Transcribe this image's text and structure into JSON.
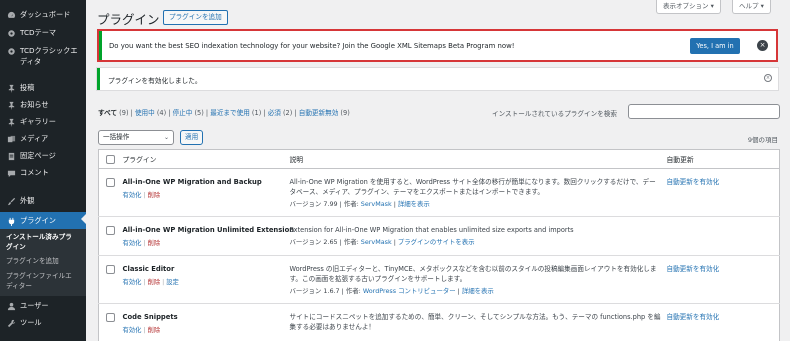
{
  "sidebar": {
    "items": [
      {
        "id": "dashboard",
        "label": "ダッシュボード",
        "icon": "dashboard-icon"
      },
      {
        "id": "tcd-theme",
        "label": "TCDテーマ",
        "icon": "gear-icon"
      },
      {
        "id": "tcd-classic",
        "label": "TCDクラシックエディタ",
        "icon": "gear-icon"
      },
      {
        "id": "posts",
        "label": "投稿",
        "icon": "pin-icon"
      },
      {
        "id": "news",
        "label": "お知らせ",
        "icon": "pin-icon"
      },
      {
        "id": "gallery",
        "label": "ギャラリー",
        "icon": "pin-icon"
      },
      {
        "id": "media",
        "label": "メディア",
        "icon": "media-icon"
      },
      {
        "id": "pages",
        "label": "固定ページ",
        "icon": "page-icon"
      },
      {
        "id": "comments",
        "label": "コメント",
        "icon": "comment-icon"
      },
      {
        "id": "appearance",
        "label": "外観",
        "icon": "brush-icon"
      },
      {
        "id": "plugins",
        "label": "プラグイン",
        "icon": "plugin-icon"
      },
      {
        "id": "users",
        "label": "ユーザー",
        "icon": "user-icon"
      },
      {
        "id": "tools",
        "label": "ツール",
        "icon": "wrench-icon"
      }
    ],
    "submenu": [
      "インストール済みプラグイン",
      "プラグインを追加",
      "プラグインファイルエディター"
    ]
  },
  "header": {
    "title": "プラグイン",
    "add_button": "プラグインを追加",
    "screen_options": "表示オプション ▾",
    "help": "ヘルプ ▾"
  },
  "notice_xml": {
    "message": "Do you want the best SEO indexation technology for your website? Join the Google XML Sitemaps Beta Program now!",
    "yes_button": "Yes, I am in",
    "dismiss": "×"
  },
  "notice_ok": {
    "message": "プラグインを有効化しました。",
    "dismiss": "×"
  },
  "filters": [
    {
      "label": "すべて",
      "count": "(9)",
      "current": true
    },
    {
      "label": "使用中",
      "count": "(4)"
    },
    {
      "label": "停止中",
      "count": "(5)"
    },
    {
      "label": "最近まで使用",
      "count": "(1)"
    },
    {
      "label": "必須",
      "count": "(2)"
    },
    {
      "label": "自動更新無効",
      "count": "(9)"
    }
  ],
  "search": {
    "label": "インストールされているプラグインを検索",
    "placeholder": ""
  },
  "bulk": {
    "selected": "一括操作",
    "apply": "適用"
  },
  "items_count": "9個の項目",
  "table": {
    "headers": {
      "plugin": "プラグイン",
      "description": "説明",
      "auto_update": "自動更新"
    },
    "rows": [
      {
        "name": "All-in-One WP Migration and Backup",
        "actions": [
          "有効化",
          "削除"
        ],
        "description": "All-in-One WP Migration を使用すると、WordPress サイト全体の移行が簡単になります。数回クリックするだけで、データベース、メディア、プラグイン、テーマをエクスポートまたはインポートできます。",
        "version": "バージョン 7.99",
        "author_label": "作者:",
        "author": "ServMask",
        "details": "詳細を表示",
        "auto_update": "自動更新を有効化"
      },
      {
        "name": "All-in-One WP Migration Unlimited Extension",
        "actions": [
          "有効化",
          "削除"
        ],
        "description": "Extension for All-in-One WP Migration that enables unlimited size exports and imports",
        "version": "バージョン 2.65",
        "author_label": "作者:",
        "author": "ServMask",
        "details": "プラグインのサイトを表示",
        "auto_update": ""
      },
      {
        "name": "Classic Editor",
        "actions": [
          "有効化",
          "削除",
          "設定"
        ],
        "description": "WordPress の旧エディターと、TinyMCE、メタボックスなどを含む以前のスタイルの投稿編集画面レイアウトを有効化します。この画面を拡張する古いプラグインをサポートします。",
        "version": "バージョン 1.6.7",
        "author_label": "作者:",
        "author": "WordPress コントリビューター",
        "details": "詳細を表示",
        "auto_update": "自動更新を有効化"
      },
      {
        "name": "Code Snippets",
        "actions": [
          "有効化",
          "削除"
        ],
        "description": "サイトにコードスニペットを追加するための、簡単、クリーン、そしてシンプルな方法。もう、テーマの functions.php を編集する必要はありませんよ！",
        "version": "",
        "author_label": "",
        "author": "",
        "details": "",
        "auto_update": "自動更新を有効化"
      }
    ]
  }
}
